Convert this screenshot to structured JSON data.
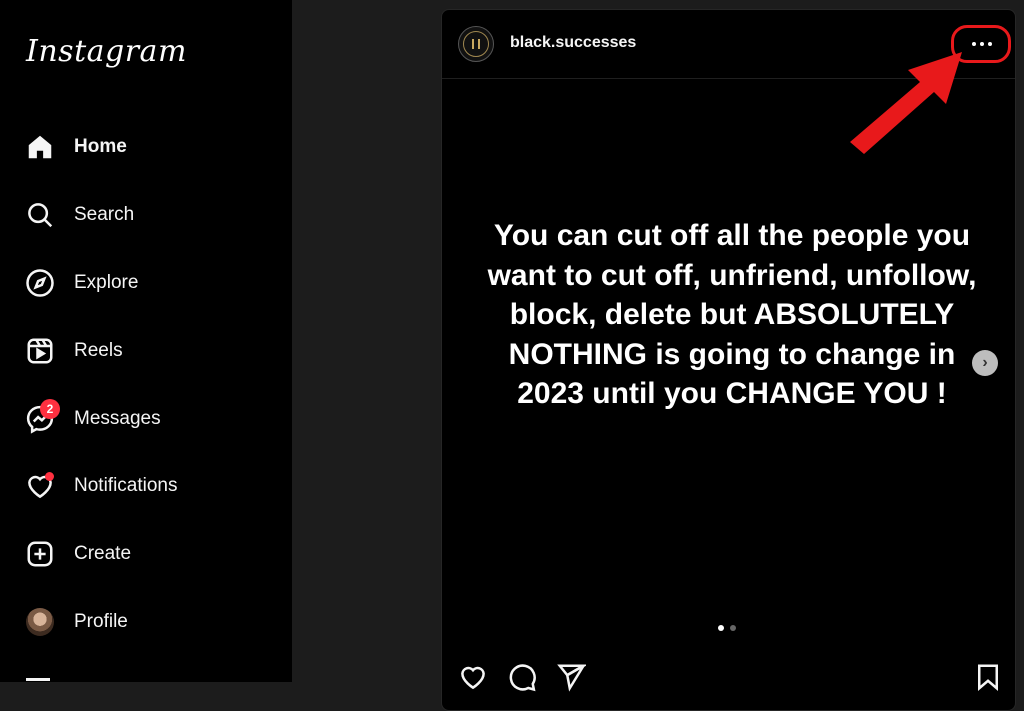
{
  "sidebar": {
    "logo": "Instagram",
    "items": [
      {
        "label": "Home",
        "icon": "home-icon"
      },
      {
        "label": "Search",
        "icon": "search-icon"
      },
      {
        "label": "Explore",
        "icon": "compass-icon"
      },
      {
        "label": "Reels",
        "icon": "reels-icon"
      },
      {
        "label": "Messages",
        "icon": "messenger-icon",
        "badge": "2"
      },
      {
        "label": "Notifications",
        "icon": "heart-icon"
      },
      {
        "label": "Create",
        "icon": "plus-square-icon"
      },
      {
        "label": "Profile",
        "icon": "avatar"
      }
    ]
  },
  "post": {
    "username": "black.successes",
    "caption": "You can cut off all the people you want to cut off, unfriend, unfollow, block, delete but ABSOLUTELY NOTHING is going to change in 2023 until you CHANGE YOU !",
    "pager": {
      "current": 1,
      "total": 2
    }
  },
  "annotation": {
    "color": "#e8191b"
  }
}
